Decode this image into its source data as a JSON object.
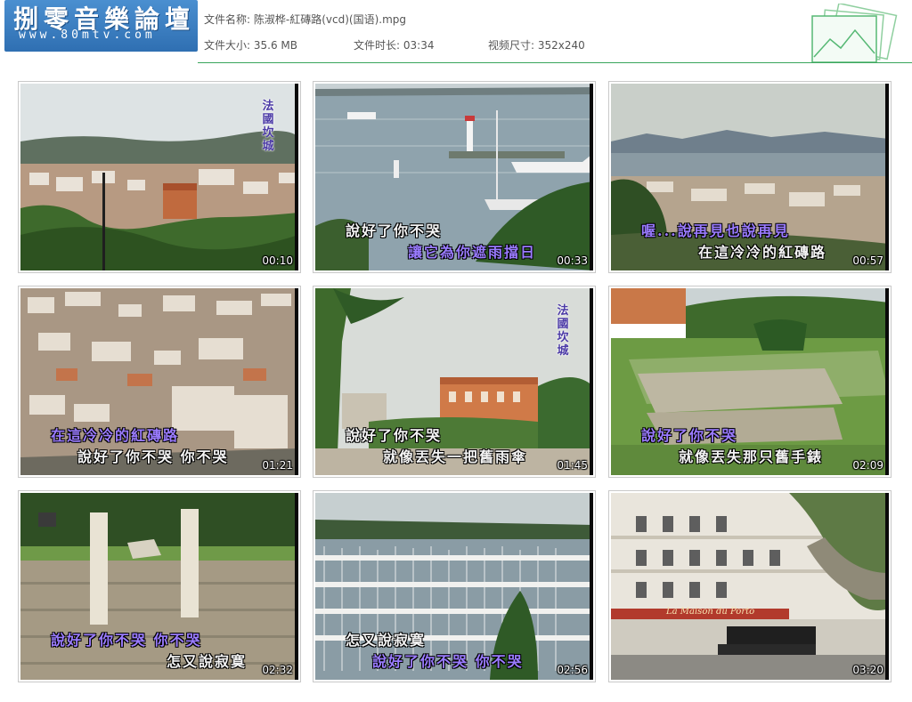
{
  "logo": {
    "title": "捌零音樂論壇",
    "url": "www.80mtv.com"
  },
  "file_info": {
    "name_label": "文件名称:",
    "name_value": "陈淑桦-紅磚路(vcd)(国语).mpg",
    "size_label": "文件大小:",
    "size_value": "35.6 MB",
    "duration_label": "文件时长:",
    "duration_value": "03:34",
    "dims_label": "视频尺寸:",
    "dims_value": "352x240"
  },
  "thumbnails": [
    {
      "time": "00:10",
      "vertical_title": "法國坎城",
      "lines": []
    },
    {
      "time": "00:33",
      "lines": [
        "說好了你不哭",
        "讓它為你遮雨擋日"
      ]
    },
    {
      "time": "00:57",
      "lines": [
        "喔...說再見也說再見",
        "在這冷冷的紅磚路"
      ]
    },
    {
      "time": "01:21",
      "lines": [
        "在這冷冷的紅磚路",
        "說好了你不哭 你不哭"
      ]
    },
    {
      "time": "01:45",
      "vertical_title": "法國坎城",
      "lines": [
        "說好了你不哭",
        "就像丟失一把舊雨傘"
      ]
    },
    {
      "time": "02:09",
      "lines": [
        "說好了你不哭",
        "就像丟失那只舊手錶"
      ]
    },
    {
      "time": "02:32",
      "lines": [
        "說好了你不哭 你不哭",
        "怎又說寂寞"
      ]
    },
    {
      "time": "02:56",
      "lines": [
        "怎又說寂寞",
        "說好了你不哭 你不哭"
      ]
    },
    {
      "time": "03:20",
      "lines": [],
      "sign": "La Maison du Porto"
    }
  ]
}
